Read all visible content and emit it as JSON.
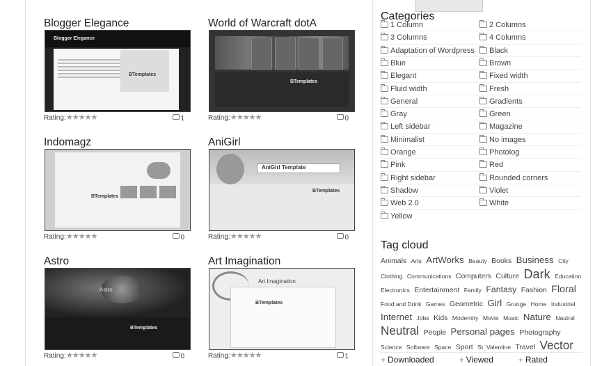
{
  "cards": [
    {
      "title": "Blogger Elegance",
      "rating_label": "Rating:",
      "stars": "★★★★★",
      "comments": "1",
      "thumb_header": "Blogger Elegance",
      "thumb_brand": "BTemplates"
    },
    {
      "title": "World of Warcraft dotA",
      "rating_label": "Rating:",
      "stars": "★★★★★",
      "comments": "0",
      "thumb_brand": "BTemplates"
    },
    {
      "title": "Indomagz",
      "rating_label": "Rating:",
      "stars": "★★★★★",
      "comments": "0",
      "thumb_brand": "BTemplates"
    },
    {
      "title": "AniGirl",
      "rating_label": "Rating:",
      "stars": "★★★★★",
      "comments": "0",
      "thumb_header": "AniGirl Template",
      "thumb_brand": "BTemplates"
    },
    {
      "title": "Astro",
      "rating_label": "Rating:",
      "stars": "★★★★★",
      "comments": "0",
      "thumb_header": "Astro",
      "thumb_brand": "BTemplates"
    },
    {
      "title": "Art Imagination",
      "rating_label": "Rating:",
      "stars": "★★★★★",
      "comments": "1",
      "thumb_header": "Art Imagination",
      "thumb_brand": "BTemplates"
    }
  ],
  "sidebar": {
    "categories_title": "Categories",
    "categories": [
      "1 Column",
      "2 Columns",
      "3 Columns",
      "4 Columns",
      "Adaptation of Wordpress",
      "Black",
      "Blue",
      "Brown",
      "Elegant",
      "Fixed width",
      "Fluid width",
      "Fresh",
      "General",
      "Gradients",
      "Gray",
      "Green",
      "Left sidebar",
      "Magazine",
      "Minimalist",
      "No images",
      "Orange",
      "Photolog",
      "Pink",
      "Red",
      "Right sidebar",
      "Rounded corners",
      "Shadow",
      "Violet",
      "Web 2.0",
      "White",
      "Yellow"
    ],
    "tag_cloud_title": "Tag cloud",
    "tags": [
      {
        "t": "Animals",
        "s": 11
      },
      {
        "t": "Arts",
        "s": 9
      },
      {
        "t": "ArtWorks",
        "s": 14
      },
      {
        "t": "Beauty",
        "s": 9
      },
      {
        "t": "Books",
        "s": 11
      },
      {
        "t": "Business",
        "s": 14
      },
      {
        "t": "City",
        "s": 9
      },
      {
        "t": "Clothing",
        "s": 9
      },
      {
        "t": "Communications",
        "s": 9
      },
      {
        "t": "Computers",
        "s": 11
      },
      {
        "t": "Culture",
        "s": 11
      },
      {
        "t": "Dark",
        "s": 19
      },
      {
        "t": "Education",
        "s": 9
      },
      {
        "t": "Electronics",
        "s": 9
      },
      {
        "t": "Entertainment",
        "s": 11
      },
      {
        "t": "Family",
        "s": 9
      },
      {
        "t": "Fantasy",
        "s": 13
      },
      {
        "t": "Fashion",
        "s": 11
      },
      {
        "t": "Floral",
        "s": 15
      },
      {
        "t": "Food and Drink",
        "s": 9
      },
      {
        "t": "Games",
        "s": 9
      },
      {
        "t": "Geometric",
        "s": 11
      },
      {
        "t": "Girl",
        "s": 14
      },
      {
        "t": "Grunge",
        "s": 9
      },
      {
        "t": "Home",
        "s": 9
      },
      {
        "t": "Industrial",
        "s": 9
      },
      {
        "t": "Internet",
        "s": 14
      },
      {
        "t": "Jobs",
        "s": 9
      },
      {
        "t": "Kids",
        "s": 11
      },
      {
        "t": "Modernity",
        "s": 9
      },
      {
        "t": "Movie",
        "s": 9
      },
      {
        "t": "Music",
        "s": 9
      },
      {
        "t": "Nature",
        "s": 14
      },
      {
        "t": "Nautral",
        "s": 9
      },
      {
        "t": "Neutral",
        "s": 18
      },
      {
        "t": "People",
        "s": 11
      },
      {
        "t": "Personal pages",
        "s": 14
      },
      {
        "t": "Photography",
        "s": 11
      },
      {
        "t": "Science",
        "s": 9
      },
      {
        "t": "Software",
        "s": 9
      },
      {
        "t": "Space",
        "s": 9
      },
      {
        "t": "Sport",
        "s": 11
      },
      {
        "t": "St. Valentine",
        "s": 9
      },
      {
        "t": "Travel",
        "s": 11
      },
      {
        "t": "Vector",
        "s": 18
      }
    ],
    "bottom_tabs": [
      "Downloaded",
      "Viewed",
      "Rated"
    ]
  }
}
